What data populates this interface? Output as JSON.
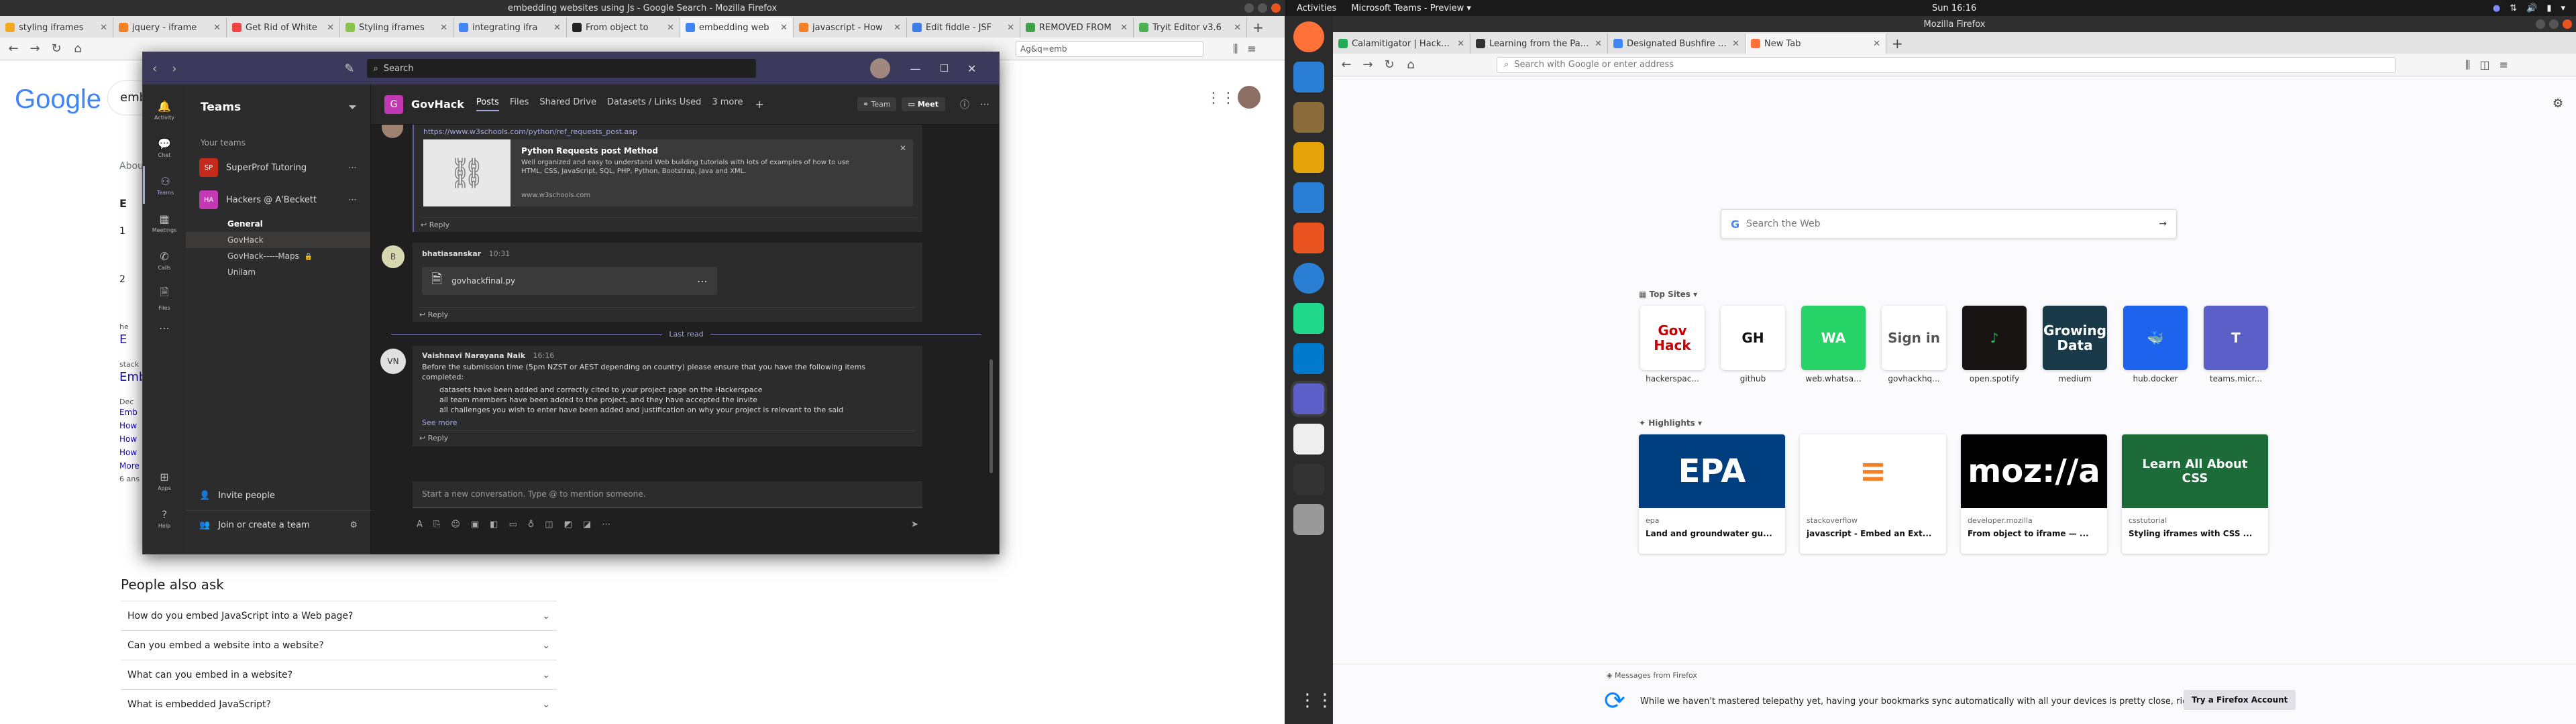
{
  "left_window": {
    "title": "embedding websites using Js - Google Search - Mozilla Firefox",
    "tabs": [
      {
        "label": "styling iframes",
        "color": "#f5a623"
      },
      {
        "label": "jquery - iframe",
        "color": "#f48024"
      },
      {
        "label": "Get Rid of White",
        "color": "#e44"
      },
      {
        "label": "Styling iframes",
        "color": "#8bc34a"
      },
      {
        "label": "integrating ifra",
        "color": "#4285f4"
      },
      {
        "label": "From object to",
        "color": "#222"
      },
      {
        "label": "embedding web",
        "color": "#4285f4"
      },
      {
        "label": "javascript - How",
        "color": "#f48024"
      },
      {
        "label": "Edit fiddle - JSF",
        "color": "#3d7de8"
      },
      {
        "label": "REMOVED FROM",
        "color": "#43a047"
      },
      {
        "label": "Tryit Editor v3.6",
        "color": "#4caf50"
      }
    ],
    "url_fragment": "Ag&q=emb",
    "google_logo": "Google",
    "search_partial": "emb",
    "about_partial": "Abou",
    "results_partial": [
      {
        "text": "E",
        "kind": "head"
      },
      {
        "text": "1",
        "kind": "num"
      },
      {
        "text": "2",
        "kind": "num"
      },
      {
        "text": "he",
        "kind": "small"
      },
      {
        "text": "E",
        "kind": "link"
      },
      {
        "text": "stack",
        "kind": "small"
      },
      {
        "text": "Emb",
        "kind": "link"
      },
      {
        "text": "Dec",
        "kind": "small"
      },
      {
        "text": "Emb",
        "kind": "link2"
      },
      {
        "text": "How",
        "kind": "link2"
      },
      {
        "text": "How",
        "kind": "link2"
      },
      {
        "text": "How",
        "kind": "link2"
      },
      {
        "text": "More",
        "kind": "link2"
      },
      {
        "text": "6 ans",
        "kind": "small"
      }
    ],
    "people_also_ask": {
      "heading": "People also ask",
      "items": [
        "How do you embed JavaScript into a Web page?",
        "Can you embed a website into a website?",
        "What can you embed in a website?",
        "What is embedded JavaScript?"
      ]
    }
  },
  "teams": {
    "search_placeholder": "Search",
    "rail": [
      {
        "label": "Activity",
        "icon": "bell-icon"
      },
      {
        "label": "Chat",
        "icon": "chat-icon"
      },
      {
        "label": "Teams",
        "icon": "teams-icon"
      },
      {
        "label": "Meetings",
        "icon": "calendar-icon"
      },
      {
        "label": "Calls",
        "icon": "phone-icon"
      },
      {
        "label": "Files",
        "icon": "file-icon"
      },
      {
        "label": "Apps",
        "icon": "apps-icon"
      },
      {
        "label": "Help",
        "icon": "help-icon"
      }
    ],
    "sidebar": {
      "title": "Teams",
      "your_teams": "Your teams",
      "teams": [
        {
          "name": "SuperProf Tutoring",
          "avatar": "SP",
          "color": "#c42b1c"
        },
        {
          "name": "Hackers @ A'Beckett",
          "avatar": "HA",
          "color": "#c239b3"
        }
      ],
      "channels": [
        "General",
        "GovHack",
        "GovHack-----Maps",
        "Unilam"
      ],
      "invite": "Invite people",
      "join": "Join or create a team"
    },
    "header": {
      "avatar": "G",
      "channel": "GovHack",
      "tabs": [
        "Posts",
        "Files",
        "Shared Drive",
        "Datasets / Links Used",
        "3 more"
      ],
      "team_btn": "Team",
      "meet_btn": "Meet"
    },
    "messages": {
      "link_url": "https://www.w3schools.com/python/ref_requests_post.asp",
      "card_title": "Python Requests post Method",
      "card_desc": "Well organized and easy to understand Web building tutorials with lots of examples of how to use HTML, CSS, JavaScript, SQL, PHP, Python, Bootstrap, Java and XML.",
      "card_domain": "www.w3schools.com",
      "reply": "Reply",
      "msg2_author": "bhatiasanskar",
      "msg2_time": "10:31",
      "msg2_avatar": "B",
      "file_name": "govhackfinal.py",
      "last_read": "Last read",
      "msg3_avatar": "VN",
      "msg3_author": "Vaishnavi Narayana Naik",
      "msg3_time": "16:16",
      "msg3_body": "Before the submission time (5pm NZST or AEST depending on country) please ensure that you have the following items completed:",
      "msg3_bullets": [
        "datasets have been added and correctly cited to your project page on the Hackerspace",
        "all team members have been added to the project, and they have accepted the invite",
        "all challenges you wish to enter have been added and justification on why your project is relevant to the said"
      ],
      "see_more": "See more",
      "compose_placeholder": "Start a new conversation. Type @ to mention someone."
    }
  },
  "top_bar": {
    "activities": "Activities",
    "app": "Microsoft Teams - Preview",
    "clock": "Sun 16:16"
  },
  "dock": [
    {
      "name": "firefox",
      "color": "#ff7139"
    },
    {
      "name": "thunderbird",
      "color": "#2a7fd4"
    },
    {
      "name": "files",
      "color": "#8a6d3b"
    },
    {
      "name": "rhythmbox",
      "color": "#e5a50a"
    },
    {
      "name": "writer",
      "color": "#2a7fd4"
    },
    {
      "name": "software",
      "color": "#e95420"
    },
    {
      "name": "help",
      "color": "#2a7fd4"
    },
    {
      "name": "pycharm",
      "color": "#21d789"
    },
    {
      "name": "vscode",
      "color": "#007acc"
    },
    {
      "name": "teams",
      "color": "#5b5fc7"
    },
    {
      "name": "text-editor",
      "color": "#eeeeee"
    },
    {
      "name": "terminal",
      "color": "#333333"
    },
    {
      "name": "disks",
      "color": "#999999"
    }
  ],
  "right_window": {
    "title": "Mozilla Firefox",
    "tabs": [
      {
        "label": "Calamitigator | Hackers",
        "color": "#2a5"
      },
      {
        "label": "Learning from the Past |",
        "color": "#333"
      },
      {
        "label": "Designated Bushfire Pro",
        "color": "#4285f4"
      },
      {
        "label": "New Tab",
        "color": "#ff7139",
        "active": true
      }
    ],
    "url_placeholder": "Search with Google or enter address",
    "search_placeholder": "Search the Web",
    "top_sites_heading": "Top Sites",
    "top_sites": [
      {
        "label": "hackerspac...",
        "bg": "#ffffff",
        "fg": "#c00",
        "glyph": "Gov Hack"
      },
      {
        "label": "github",
        "bg": "#ffffff",
        "fg": "#111",
        "glyph": "GH"
      },
      {
        "label": "web.whatsa...",
        "bg": "#25d366",
        "fg": "#fff",
        "glyph": "WA"
      },
      {
        "label": "govhackhq...",
        "bg": "#ffffff",
        "fg": "#555",
        "glyph": "Sign in"
      },
      {
        "label": "open.spotify",
        "bg": "#191414",
        "fg": "#1db954",
        "glyph": "♪"
      },
      {
        "label": "medium",
        "bg": "#1a3a4a",
        "fg": "#fff",
        "glyph": "Growing Data"
      },
      {
        "label": "hub.docker",
        "bg": "#1d63ed",
        "fg": "#fff",
        "glyph": "🐳"
      },
      {
        "label": "teams.micr...",
        "bg": "#5b5fc7",
        "fg": "#fff",
        "glyph": "T"
      }
    ],
    "highlights_heading": "Highlights",
    "highlights": [
      {
        "source": "epa",
        "title": "Land and groundwater gu...",
        "bg": "#003f7f",
        "fg": "#fff",
        "glyph": "EPA"
      },
      {
        "source": "stackoverflow",
        "title": "javascript - Embed an Ext...",
        "bg": "#ffffff",
        "fg": "#f48024",
        "glyph": "≡"
      },
      {
        "source": "developer.mozilla",
        "title": "From object to iframe — ...",
        "bg": "#000000",
        "fg": "#fff",
        "glyph": "moz://a"
      },
      {
        "source": "csstutorial",
        "title": "Styling iframes with CSS ...",
        "bg": "#1e6b3a",
        "fg": "#fff",
        "glyph": "Learn All About CSS"
      }
    ],
    "message_heading": "Messages from Firefox",
    "message_body": "While we haven't mastered telepathy yet, having your bookmarks sync automatically with all your devices is pretty close, right?",
    "message_cta": "Try a Firefox Account"
  }
}
